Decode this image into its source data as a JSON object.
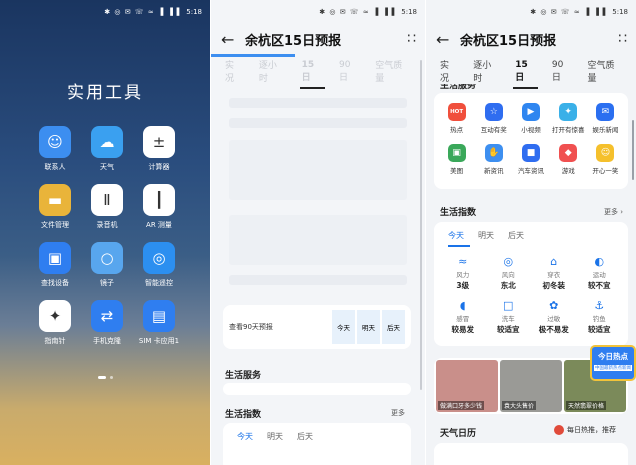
{
  "status": {
    "time": "5:18",
    "icons": "✱ ◎ ✉ ☏ ≈ ▐ ▐▐"
  },
  "home": {
    "title": "实用工具",
    "apps": [
      {
        "label": "联系人",
        "icon": "contacts-icon",
        "glyph": "☺",
        "color": "#3c8ef0"
      },
      {
        "label": "天气",
        "icon": "weather-icon",
        "glyph": "☁",
        "color": "#3aa0f0"
      },
      {
        "label": "计算器",
        "icon": "calculator-icon",
        "glyph": "±",
        "color": "#ffffff"
      },
      {
        "label": "文件管理",
        "icon": "folder-icon",
        "glyph": "▬",
        "color": "#e9b43a"
      },
      {
        "label": "录音机",
        "icon": "recorder-icon",
        "glyph": "Ⅱ",
        "color": "#ffffff"
      },
      {
        "label": "AR 测量",
        "icon": "ruler-icon",
        "glyph": "┃",
        "color": "#ffffff"
      },
      {
        "label": "查找设备",
        "icon": "find-device-icon",
        "glyph": "▣",
        "color": "#2f7ef0"
      },
      {
        "label": "镜子",
        "icon": "mirror-icon",
        "glyph": "○",
        "color": "#58a6ee"
      },
      {
        "label": "智能遥控",
        "icon": "remote-icon",
        "glyph": "◎",
        "color": "#2c8ff0"
      },
      {
        "label": "指南针",
        "icon": "compass-icon",
        "glyph": "✦",
        "color": "#ffffff"
      },
      {
        "label": "手机克隆",
        "icon": "phone-clone-icon",
        "glyph": "⇄",
        "color": "#2f7ef0"
      },
      {
        "label": "SIM 卡应用1",
        "icon": "sim-icon",
        "glyph": "▤",
        "color": "#2f7ef0"
      }
    ]
  },
  "mid": {
    "back": "←",
    "title": "余杭区15日预报",
    "more": "∷",
    "tabs": [
      "实况",
      "逐小时",
      "15日",
      "90日",
      "空气质量"
    ],
    "tab90_label": "查看90天预报",
    "day_tabs": [
      "今天",
      "明天",
      "后天"
    ],
    "service_title": "生活服务",
    "index_title": "生活指数",
    "index_more": "更多",
    "index_tabs": [
      "今天",
      "明天",
      "后天"
    ]
  },
  "right": {
    "back": "←",
    "title": "余杭区15日预报",
    "more": "∷",
    "tabs": [
      "实况",
      "逐小时",
      "15日",
      "90日",
      "空气质量"
    ],
    "service_title": "生活服务",
    "services": [
      {
        "label": "热点",
        "glyph": "HOT",
        "icon": "hot-icon",
        "color": "#f04f3c"
      },
      {
        "label": "互动有奖",
        "glyph": "☆",
        "icon": "reward-icon",
        "color": "#2f6df0"
      },
      {
        "label": "小视频",
        "glyph": "▶",
        "icon": "video-icon",
        "color": "#2f86f0"
      },
      {
        "label": "打开有惊喜",
        "glyph": "✦",
        "icon": "surprise-icon",
        "color": "#3ab0e8"
      },
      {
        "label": "娱乐新闻",
        "glyph": "✉",
        "icon": "news-icon",
        "color": "#2b6ff0"
      },
      {
        "label": "美图",
        "glyph": "▣",
        "icon": "photo-icon",
        "color": "#3aa85a"
      },
      {
        "label": "新资讯",
        "glyph": "✋",
        "icon": "info-icon",
        "color": "#3d8ff0"
      },
      {
        "label": "汽车资讯",
        "glyph": "■",
        "icon": "car-icon",
        "color": "#2f6df0"
      },
      {
        "label": "游戏",
        "glyph": "◆",
        "icon": "game-icon",
        "color": "#f05050"
      },
      {
        "label": "开心一笑",
        "glyph": "☺",
        "icon": "smile-icon",
        "color": "#f5c02c"
      }
    ],
    "index_title": "生活指数",
    "index_more": "更多",
    "index_tabs": [
      "今天",
      "明天",
      "后天"
    ],
    "indices": [
      {
        "name": "风力",
        "value": "3级",
        "glyph": "≈",
        "icon": "wind-icon"
      },
      {
        "name": "风向",
        "value": "东北",
        "glyph": "◎",
        "icon": "direction-icon"
      },
      {
        "name": "穿衣",
        "value": "初冬装",
        "glyph": "⌂",
        "icon": "clothing-icon"
      },
      {
        "name": "运动",
        "value": "较不宜",
        "glyph": "◐",
        "icon": "sport-icon"
      },
      {
        "name": "感冒",
        "value": "较易发",
        "glyph": "◖",
        "icon": "cold-icon"
      },
      {
        "name": "洗车",
        "value": "较适宜",
        "glyph": "□",
        "icon": "carwash-icon"
      },
      {
        "name": "过敏",
        "value": "极不易发",
        "glyph": "✿",
        "icon": "allergy-icon"
      },
      {
        "name": "钓鱼",
        "value": "较适宜",
        "glyph": "⚓",
        "icon": "fishing-icon"
      }
    ],
    "ads": [
      "做满口牙多少钱",
      "袁大头售价",
      "天然翡翠价格"
    ],
    "hot_badge": "今日热点",
    "hot_sub": "中国最新热点新闻",
    "calendar_title": "天气日历",
    "calendar_tag": "每日热推，推荐"
  }
}
